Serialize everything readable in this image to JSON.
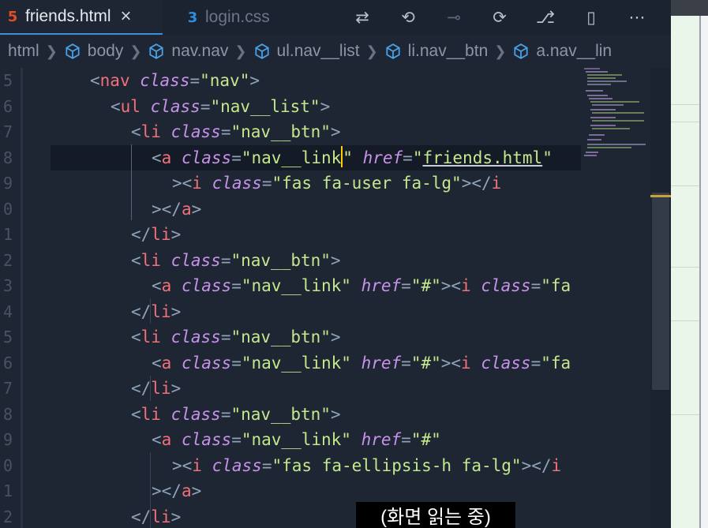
{
  "tabs": [
    {
      "icon": "html5-icon",
      "glyph": "5",
      "label": "friends.html",
      "active": true,
      "close": "×"
    },
    {
      "icon": "css3-icon",
      "glyph": "3",
      "label": "login.css",
      "active": false
    }
  ],
  "tab_actions": [
    {
      "name": "source-control-compare-icon",
      "glyph": "⇄"
    },
    {
      "name": "go-back-icon",
      "glyph": "⟲"
    },
    {
      "name": "commit-icon",
      "glyph": "⊸"
    },
    {
      "name": "go-forward-icon",
      "glyph": "⟳"
    },
    {
      "name": "git-branch-icon",
      "glyph": "⎇"
    },
    {
      "name": "split-editor-icon",
      "glyph": "▯"
    },
    {
      "name": "more-actions-icon",
      "glyph": "⋯"
    }
  ],
  "breadcrumb": [
    "html",
    "body",
    "nav.nav",
    "ul.nav__list",
    "li.nav__btn",
    "a.nav__lin"
  ],
  "line_numbers": [
    "5",
    "6",
    "7",
    "8",
    "9",
    "0",
    "1",
    "2",
    "3",
    "4",
    "5",
    "6",
    "7",
    "8",
    "9",
    "0",
    "1",
    "2"
  ],
  "code": {
    "l1_tag": "nav",
    "l1_attr": "class",
    "l1_val": "\"nav\"",
    "l2_tag": "ul",
    "l2_attr": "class",
    "l2_val": "\"nav__list\"",
    "l3_tag": "li",
    "l3_attr": "class",
    "l3_val": "\"nav__btn\"",
    "l4_tag": "a",
    "l4_attr": "class",
    "l4_val_a": "\"nav__link",
    "l4_val_b": "\"",
    "l4_attr2": "href",
    "l4_val2_q": "\"",
    "l4_val2": "friends.html",
    "l4_val2_e": "\"",
    "l5_tag": "i",
    "l5_attr": "class",
    "l5_val": "\"fas fa-user fa-lg\"",
    "l5_close": "i",
    "l6_tag": "a",
    "l7_tag": "li",
    "l8_tag": "li",
    "l8_attr": "class",
    "l8_val": "\"nav__btn\"",
    "l9_tag": "a",
    "l9_attr": "class",
    "l9_val": "\"nav__link\"",
    "l9_attr2": "href",
    "l9_val2": "\"#\"",
    "l9_tag2": "i",
    "l9_attr3": "class",
    "l9_tail": "\"fa",
    "l10_tag": "li",
    "l11_tag": "li",
    "l11_attr": "class",
    "l11_val": "\"nav__btn\"",
    "l12_tag": "a",
    "l12_attr": "class",
    "l12_val": "\"nav__link\"",
    "l12_attr2": "href",
    "l12_val2": "\"#\"",
    "l12_tag2": "i",
    "l12_attr3": "class",
    "l12_tail": "\"fa",
    "l13_tag": "li",
    "l14_tag": "li",
    "l14_attr": "class",
    "l14_val": "\"nav__btn\"",
    "l15_tag": "a",
    "l15_attr": "class",
    "l15_val": "\"nav__link\"",
    "l15_attr2": "href",
    "l15_val2": "\"#\"",
    "l16_tag": "i",
    "l16_attr": "class",
    "l16_val": "\"fas fa-ellipsis-h fa-lg\"",
    "l16_close": "i",
    "l17_tag": "a",
    "l18_tag": "li"
  },
  "caption": "(화면 읽는 중)",
  "colors": {
    "tag": "#f0717a",
    "attr": "#c792ea",
    "string": "#c3e88d",
    "punct": "#8fa3b8",
    "cursor": "#ffcc00"
  }
}
